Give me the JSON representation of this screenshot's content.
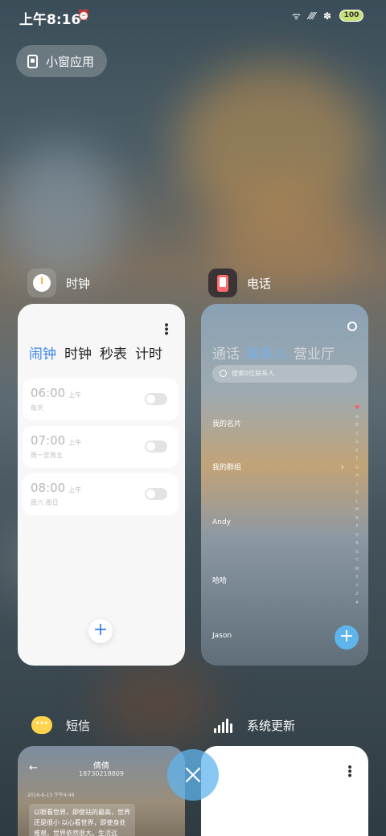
{
  "status_bar": {
    "time": "上午8:16",
    "battery": "100"
  },
  "float_window": {
    "label": "小窗应用"
  },
  "apps": {
    "clock": {
      "name": "时钟",
      "tabs": [
        "闹钟",
        "时钟",
        "秒表",
        "计时"
      ],
      "alarms": [
        {
          "time": "06:00",
          "ampm": "上午",
          "days": "每天"
        },
        {
          "time": "07:00",
          "ampm": "上午",
          "days": "周一至周五"
        },
        {
          "time": "08:00",
          "ampm": "上午",
          "days": "周六 周日"
        }
      ],
      "add_label": "+"
    },
    "phone": {
      "name": "电话",
      "tabs": [
        "通话",
        "联系人",
        "营业厅"
      ],
      "search_placeholder": "搜索0位联系人",
      "rows": [
        "我的名片",
        "我的群组",
        "Andy",
        "哈哈",
        "Jason"
      ],
      "add_label": "+"
    },
    "sms": {
      "name": "短信",
      "contact": "倩倩",
      "number": "18730218809",
      "date": "2016-6-13 下午4:49",
      "message": "以眼看世界，即使站的最高，世界还是很小 以心看世界，即使身处难艰，世界依然很大。生活远"
    },
    "update": {
      "name": "系统更新"
    }
  },
  "colors": {
    "accent": "#3b86e6",
    "close_button": "#60b4ec"
  }
}
